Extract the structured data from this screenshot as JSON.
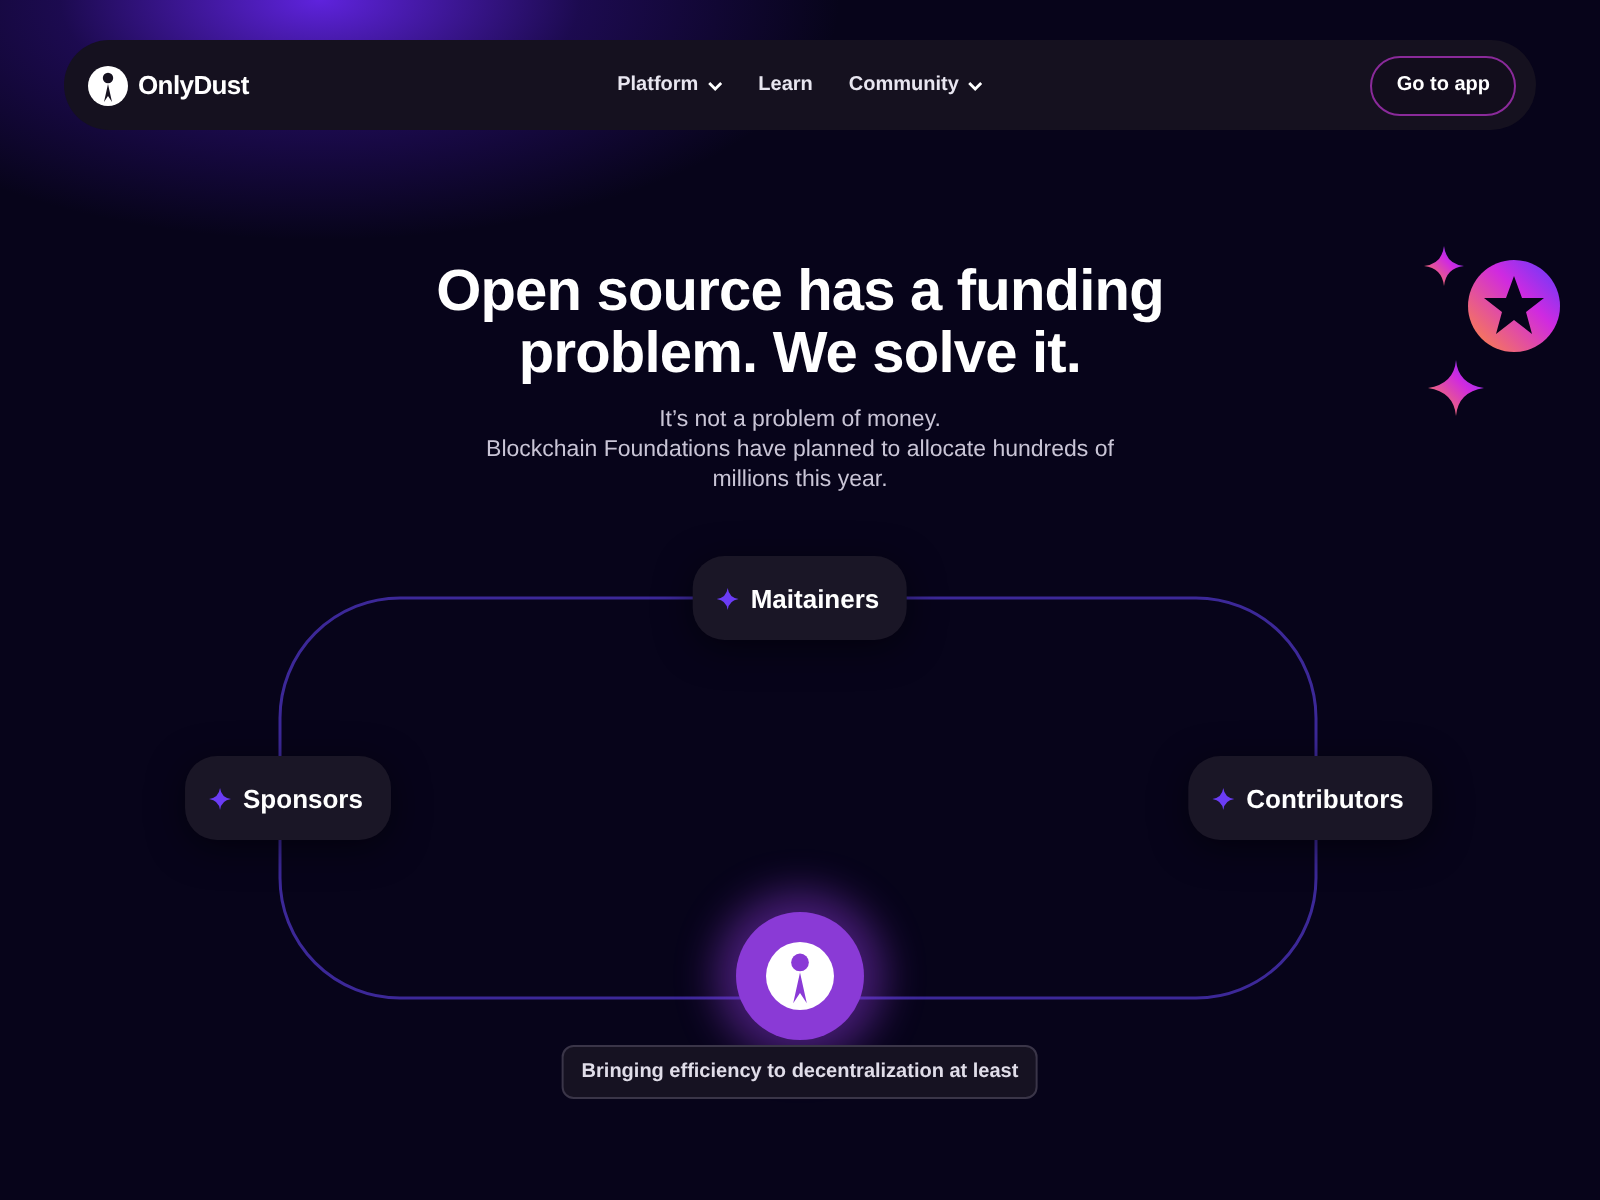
{
  "nav": {
    "brand": "OnlyDust",
    "links": [
      {
        "label": "Platform",
        "dropdown": true
      },
      {
        "label": "Learn",
        "dropdown": false
      },
      {
        "label": "Community",
        "dropdown": true
      }
    ],
    "cta": "Go to app"
  },
  "hero": {
    "title": "Open source has a funding problem. We solve it.",
    "subtitle_lines": [
      "It’s not a problem of money.",
      "Blockchain Foundations have planned to allocate hundreds of millions this year."
    ]
  },
  "diagram": {
    "nodes": [
      {
        "label": "Maitainers",
        "kind": "top"
      },
      {
        "label": "Sponsors",
        "kind": "left"
      },
      {
        "label": "Contributors",
        "kind": "right"
      }
    ],
    "caption": "Bringing efficiency to decentralization at least"
  }
}
